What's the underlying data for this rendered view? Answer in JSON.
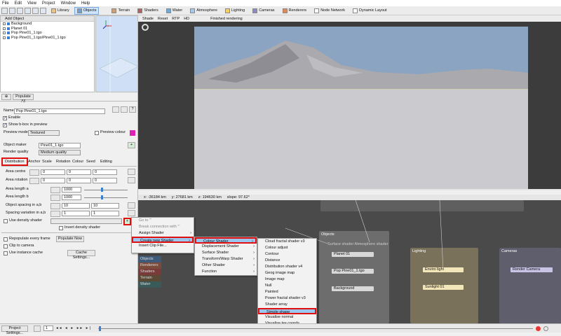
{
  "menu": [
    "File",
    "Edit",
    "View",
    "Project",
    "Window",
    "Help"
  ],
  "tabs": [
    {
      "label": "Library",
      "active": false
    },
    {
      "label": "Objects",
      "active": true
    },
    {
      "label": "Terrain",
      "active": false
    },
    {
      "label": "Shaders",
      "active": false
    },
    {
      "label": "Water",
      "active": false
    },
    {
      "label": "Atmosphere",
      "active": false
    },
    {
      "label": "Lighting",
      "active": false
    },
    {
      "label": "Cameras",
      "active": false
    },
    {
      "label": "Renderers",
      "active": false
    },
    {
      "label": "Node Network",
      "active": false
    },
    {
      "label": "Dynamic Layout",
      "active": false
    }
  ],
  "tree": {
    "header": "Add Object",
    "items": [
      "Background",
      "Planet 01",
      "Pop Pine01_1.tgo",
      "Pop Pine01_1.tgo/Pine01_1.tgo"
    ]
  },
  "populate_all": "Populate All",
  "props": {
    "name_label": "Name",
    "name_value": "Pop Pine01_1.tgo",
    "enable": "Enable",
    "show_bbox": "Show b-box in preview",
    "preview_mode_label": "Preview mode",
    "preview_mode": "Textured",
    "preview_colour": "Preview colour",
    "object_maker_label": "Object maker",
    "object_maker": "Pine01_1.tgo",
    "render_quality_label": "Render quality",
    "render_quality": "Medium quality"
  },
  "subtabs": [
    "Distribution",
    "Anchor",
    "Scale",
    "Rotation",
    "Colour",
    "Seed",
    "Editing"
  ],
  "fields": [
    {
      "label": "Area centre",
      "a": "0",
      "b": "0",
      "c": "0"
    },
    {
      "label": "Area rotation",
      "a": "0",
      "b": "0",
      "c": "0"
    },
    {
      "label": "Area length a",
      "a": "1000"
    },
    {
      "label": "Area length b",
      "a": "1000"
    },
    {
      "label": "Object spacing in a,b",
      "a": "10",
      "b": "10"
    },
    {
      "label": "Spacing variation in a,b",
      "a": "1",
      "b": "1"
    }
  ],
  "density": {
    "use": "Use density shader",
    "invert": "Invert density shader"
  },
  "repop": {
    "every": "Repopulate every frame",
    "now": "Populate Now",
    "clip": "Clip to camera",
    "instance": "Use instance cache",
    "cache": "Cache Settings..."
  },
  "viewport_bar": {
    "shade": "Shade",
    "reset": "Reset",
    "rtp": "RTP",
    "hd": "HD",
    "status": "Finished rendering"
  },
  "status": {
    "x": "x: -36184 km",
    "y": "y: 27681 km",
    "z": "z: 194630 km",
    "slope": "slope: 97.62°"
  },
  "ctx1": [
    {
      "label": "Go to '''",
      "dis": true
    },
    {
      "label": "Break connection with '''",
      "dis": true
    },
    {
      "label": "Assign Shader",
      "arrow": true
    },
    {
      "label": "Create new Shader",
      "arrow": true,
      "hl": true
    },
    {
      "label": "Insert Clip File..."
    }
  ],
  "ctx2": [
    {
      "label": "Colour Shader",
      "arrow": true,
      "hl": true
    },
    {
      "label": "Displacement Shader",
      "arrow": true
    },
    {
      "label": "Surface Shader",
      "arrow": true
    },
    {
      "label": "Transform/Warp Shader",
      "arrow": true
    },
    {
      "label": "Other Shader",
      "arrow": true
    },
    {
      "label": "Function",
      "arrow": true
    }
  ],
  "ctx3": [
    "Cloud fractal shader v3",
    "Colour adjust",
    "Contour",
    "Distance",
    "Distribution shader v4",
    "Geog image map",
    "Image map",
    "Null",
    "Painted",
    "Power fractal shader v3",
    "Shader array",
    "Simple shape",
    "Visualise normal",
    "Visualise tex coords"
  ],
  "graph": {
    "side": [
      "Objects",
      "Renderers",
      "Shaders",
      "Terrain",
      "Water"
    ],
    "objects": {
      "title": "Objects",
      "cols": "Surface shader   Atmosphere shader",
      "nodes": [
        "Planet 01",
        "Pop Pine01_1.tgo",
        "Background"
      ]
    },
    "lighting": {
      "title": "Lighting",
      "nodes": [
        "Enviro light",
        "Sunlight 01"
      ]
    },
    "cameras": {
      "title": "Cameras",
      "nodes": [
        "Render Camera"
      ]
    }
  },
  "bottom": {
    "project": "Project Settings...",
    "frame": "1"
  }
}
